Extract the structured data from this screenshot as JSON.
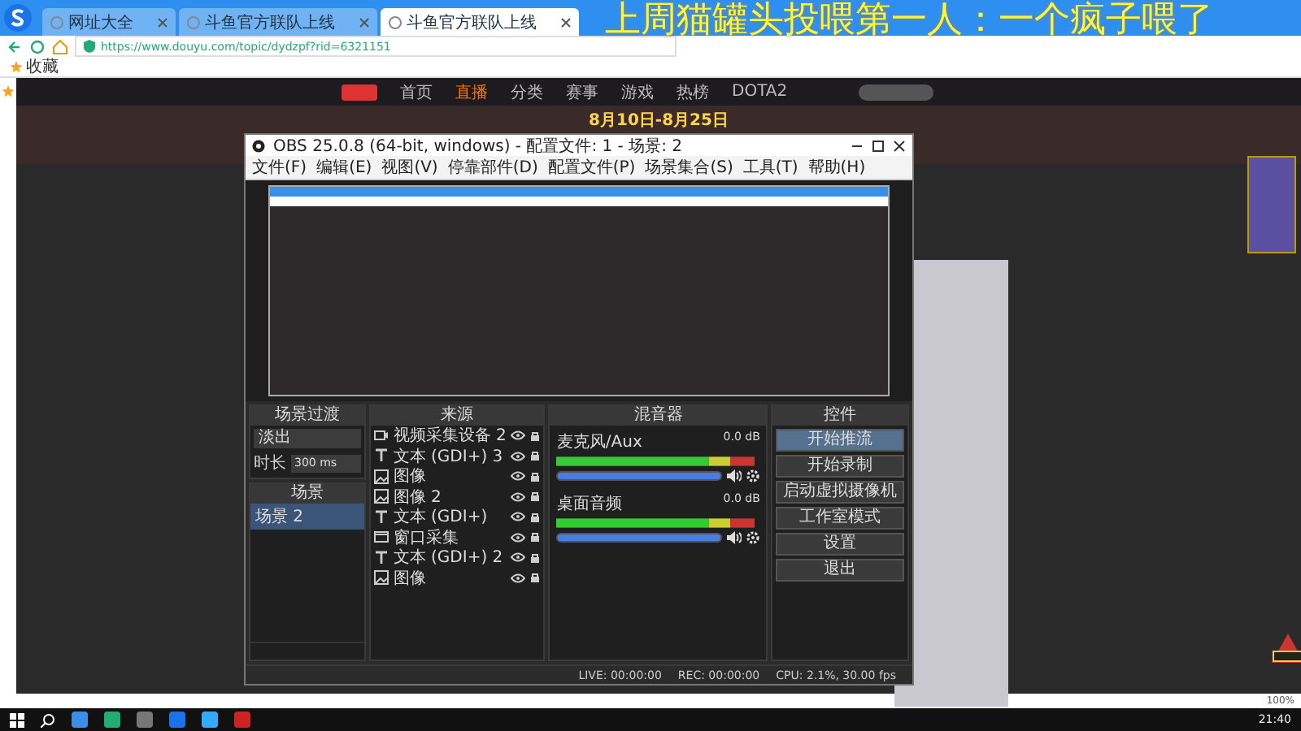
{
  "browser": {
    "tabs": [
      {
        "label": "网址大全",
        "selected": false
      },
      {
        "label": "斗鱼官方联队上线",
        "selected": false
      },
      {
        "label": "斗鱼官方联队上线",
        "selected": true
      }
    ],
    "url": "https://www.douyu.com/topic/dydzpf?rid=6321151",
    "bookmarks": [
      "收藏"
    ],
    "zoom": "100%"
  },
  "site": {
    "nav": [
      {
        "label": "首页",
        "selected": false
      },
      {
        "label": "直播",
        "selected": true
      },
      {
        "label": "分类",
        "selected": false
      },
      {
        "label": "赛事",
        "selected": false
      },
      {
        "label": "游戏",
        "selected": false
      },
      {
        "label": "热榜",
        "selected": false
      },
      {
        "label": "DOTA2",
        "selected": false
      }
    ],
    "banner_date": "8月10日-8月25日"
  },
  "overlay_text": "上周猫罐头投喂第一人：一个疯子喂了",
  "obs": {
    "title": "OBS 25.0.8 (64-bit, windows) - 配置文件: 1 - 场景: 2",
    "menu": [
      "文件(F)",
      "编辑(E)",
      "视图(V)",
      "停靠部件(D)",
      "配置文件(P)",
      "场景集合(S)",
      "工具(T)",
      "帮助(H)"
    ],
    "transitions": {
      "title": "场景过渡",
      "transition": "淡出",
      "duration_label": "时长",
      "duration": "300 ms"
    },
    "scenes": {
      "title": "场景",
      "items": [
        {
          "label": "场景 2",
          "selected": true
        }
      ]
    },
    "sources": {
      "title": "来源",
      "items": [
        {
          "label": "视频采集设备 2",
          "kind": "camera"
        },
        {
          "label": "文本 (GDI+) 3",
          "kind": "text"
        },
        {
          "label": "图像",
          "kind": "image"
        },
        {
          "label": "图像 2",
          "kind": "image"
        },
        {
          "label": "文本 (GDI+)",
          "kind": "text"
        },
        {
          "label": "窗口采集",
          "kind": "window"
        },
        {
          "label": "文本 (GDI+) 2",
          "kind": "text"
        },
        {
          "label": "图像",
          "kind": "image"
        }
      ]
    },
    "mixer": {
      "title": "混音器",
      "channels": [
        {
          "name": "麦克风/Aux",
          "reading": "0.0 dB",
          "level": 1
        },
        {
          "name": "桌面音频",
          "reading": "0.0 dB",
          "level": 1
        }
      ]
    },
    "controls": {
      "title": "控件",
      "buttons": [
        {
          "label": "开始推流",
          "selected": true
        },
        {
          "label": "开始录制",
          "selected": false
        },
        {
          "label": "启动虚拟摄像机",
          "selected": false
        },
        {
          "label": "工作室模式",
          "selected": false
        },
        {
          "label": "设置",
          "selected": false
        },
        {
          "label": "退出",
          "selected": false
        }
      ]
    },
    "status": [
      "LIVE: 00:00:00",
      "REC: 00:00:00",
      "CPU: 2.1%, 30.00 fps"
    ]
  },
  "taskbar": {
    "time": "21:40"
  }
}
